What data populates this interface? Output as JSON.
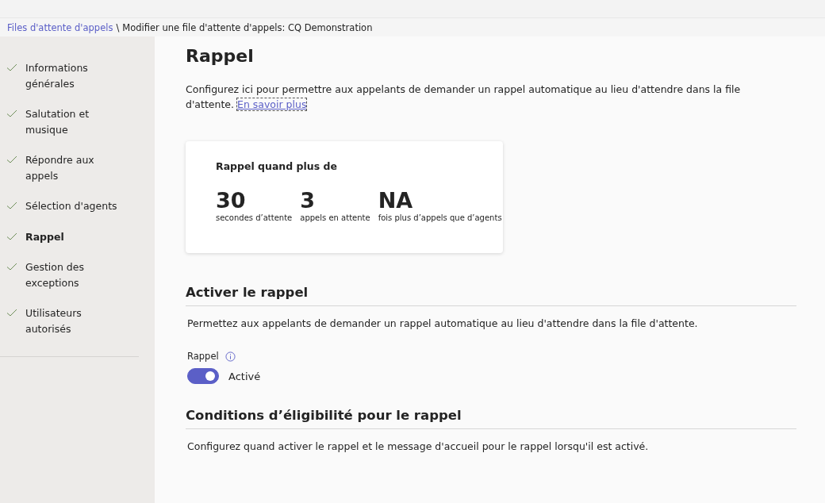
{
  "breadcrumb": {
    "link": "Files d'attente d'appels",
    "separator": "\\",
    "current": "Modifier une file d'attente d'appels: CQ Demonstration"
  },
  "sidebar": {
    "items": [
      {
        "label": "Informations générales",
        "checked": true,
        "selected": false
      },
      {
        "label": "Salutation et musique",
        "checked": true,
        "selected": false
      },
      {
        "label": "Répondre aux appels",
        "checked": true,
        "selected": false
      },
      {
        "label": "Sélection d'agents",
        "checked": true,
        "selected": false
      },
      {
        "label": "Rappel",
        "checked": true,
        "selected": true
      },
      {
        "label": "Gestion des exceptions",
        "checked": true,
        "selected": false
      },
      {
        "label": "Utilisateurs autorisés",
        "checked": true,
        "selected": false
      }
    ]
  },
  "page": {
    "title": "Rappel",
    "intro": "Configurez ici pour permettre aux appelants de demander un rappel automatique au lieu d'attendre dans la file d'attente.",
    "intro_link": "En savoir plus"
  },
  "summary_card": {
    "title": "Rappel quand plus de",
    "stats": [
      {
        "value": "30",
        "label": "secondes d’attente"
      },
      {
        "value": "3",
        "label": "appels en attente"
      },
      {
        "value": "NA",
        "label": "fois plus d’appels que d’agents"
      }
    ]
  },
  "sections": [
    {
      "kind": "toggle",
      "heading": "Activer le rappel",
      "description": "Permettez aux appelants de demander un rappel automatique au lieu d'attendre dans la file d'attente.",
      "field_label": "Rappel",
      "toggle": {
        "on": true,
        "label": "Activé"
      }
    },
    {
      "kind": "text",
      "heading": "Conditions d’éligibilité pour le rappel",
      "description": "Configurez quand activer le rappel et le message d'accueil pour le rappel lorsqu'il est activé."
    }
  ]
}
